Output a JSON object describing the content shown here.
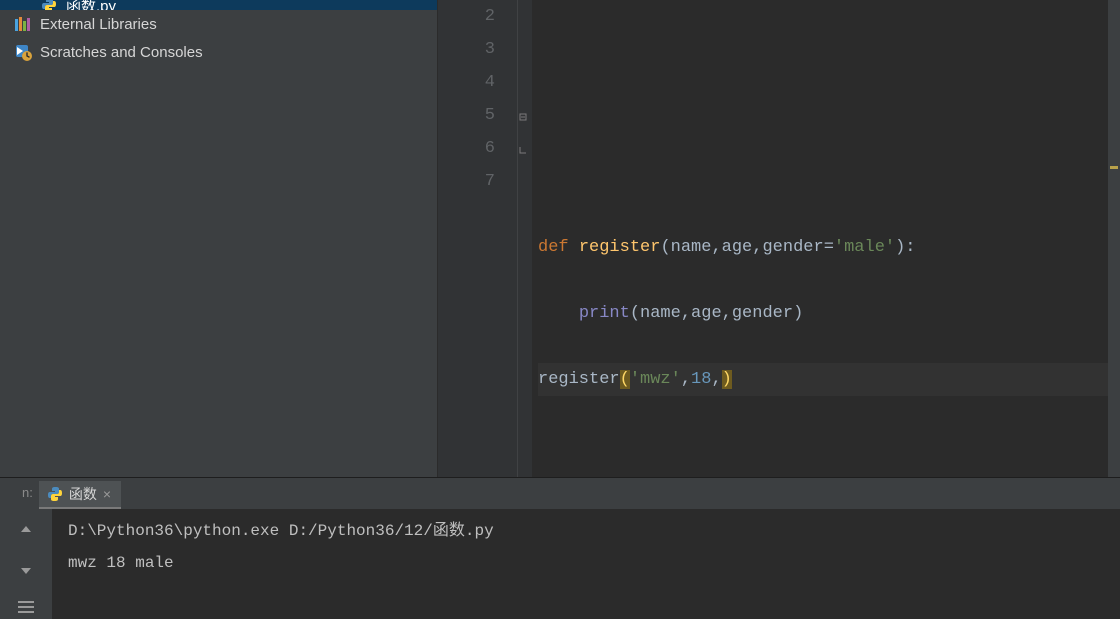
{
  "sidebar": {
    "file_item": "函数.py",
    "external_libraries": "External Libraries",
    "scratches": "Scratches and Consoles"
  },
  "gutter": {
    "l2": "2",
    "l3": "3",
    "l4": "4",
    "l5": "5",
    "l6": "6",
    "l7": "7"
  },
  "code": {
    "kw_def": "def",
    "fn_register": "register",
    "sig_open": "(",
    "p_name": "name",
    "comma": ",",
    "p_age": "age",
    "p_gender": "gender",
    "eq": "=",
    "str_male": "'male'",
    "sig_close_colon": "):",
    "indent": "    ",
    "bi_print": "print",
    "print_args_open": "(",
    "print_args_close": ")",
    "call_register": "register",
    "call_open": "(",
    "str_mwz": "'mwz'",
    "num_18": "18",
    "call_close": ")"
  },
  "run": {
    "label": "n:",
    "tab_name": "函数",
    "close": "×"
  },
  "console": {
    "line1": "D:\\Python36\\python.exe D:/Python36/12/函数.py",
    "line2": "mwz 18 male"
  },
  "toolbar": {
    "up": "↑",
    "down": "↓",
    "menu": "≡"
  }
}
